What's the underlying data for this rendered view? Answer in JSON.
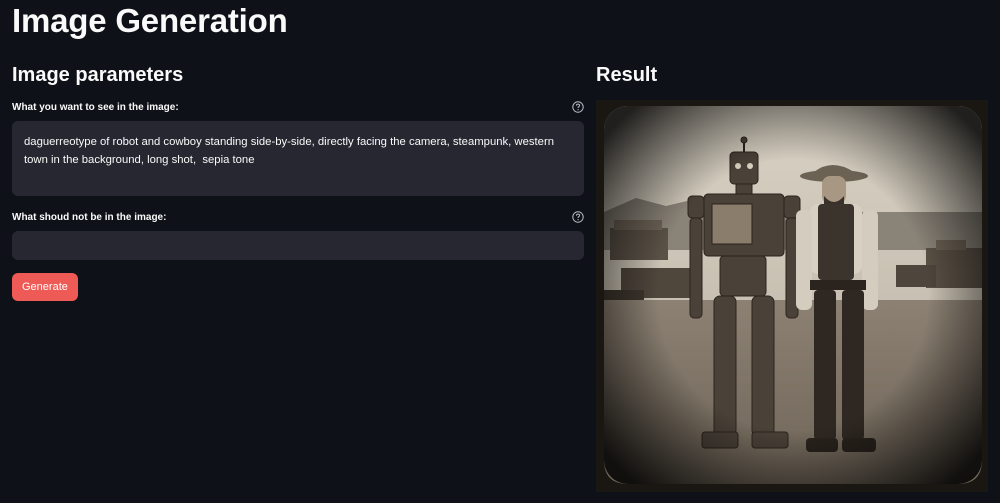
{
  "page": {
    "title": "Image Generation"
  },
  "params": {
    "heading": "Image parameters",
    "prompt_label": "What you want to see in the image:",
    "prompt_value": "daguerreotype of robot and cowboy standing side-by-side, directly facing the camera, steampunk, western town in the background, long shot,  sepia tone",
    "negative_label": "What shoud not be in the image:",
    "negative_value": "",
    "generate_label": "Generate"
  },
  "result": {
    "heading": "Result"
  },
  "icons": {
    "help": "question-circle-icon"
  },
  "colors": {
    "background": "#0e1117",
    "input_bg": "#262730",
    "primary_button": "#ee5a55",
    "text": "#fafafa"
  }
}
